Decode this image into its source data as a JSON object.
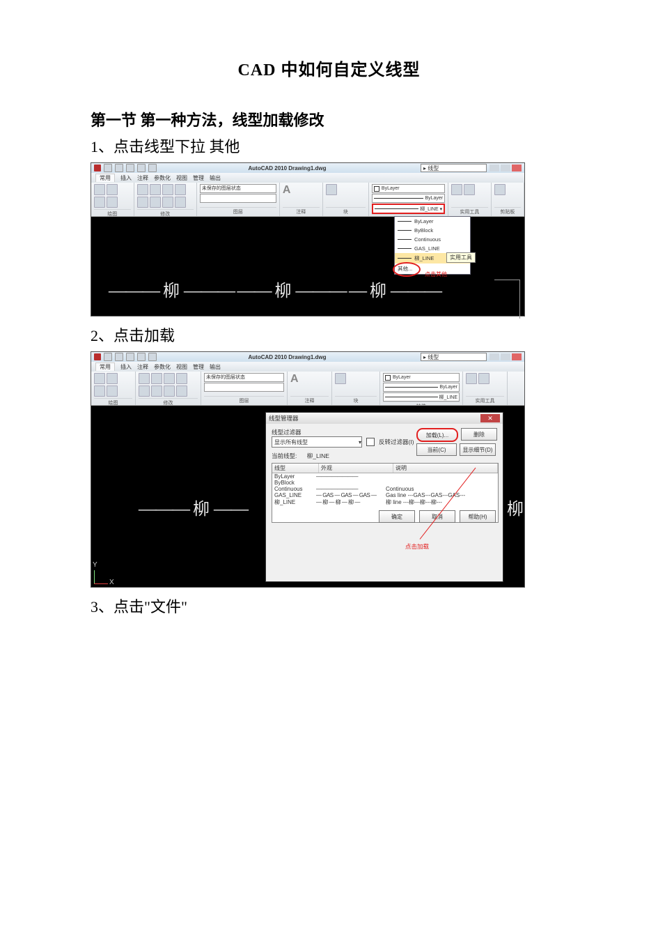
{
  "doc": {
    "title": "CAD 中如何自定义线型",
    "section1": "第一节 第一种方法，线型加载修改",
    "step1": "1、点击线型下拉   其他",
    "step2": "2、点击加载",
    "step3": "3、点击\"文件\""
  },
  "shot_common": {
    "app_title": "AutoCAD 2010   Drawing1.dwg",
    "search_placeholder": "线型",
    "tabs": [
      "常用",
      "插入",
      "注释",
      "参数化",
      "视图",
      "管理",
      "输出"
    ],
    "panels": {
      "draw": "绘图",
      "modify": "修改",
      "layer": "图层",
      "anno": "注释",
      "block": "块",
      "prop": "特性",
      "util": "实用工具",
      "clip": "剪贴板"
    },
    "prop_values": {
      "color": "ByLayer",
      "bylayer": "ByLayer",
      "linetype": "柳_LINE"
    },
    "layer_state": "未保存的图层状态"
  },
  "shot1": {
    "dropdown": {
      "items": [
        "ByLayer",
        "ByBlock",
        "Continuous",
        "GAS_LINE",
        "柳_LINE",
        "其他..."
      ],
      "selected_index": 4
    },
    "tooltip": "实用工具",
    "annotation": "点击其他",
    "canvas_chars": [
      "柳",
      "柳",
      "柳"
    ]
  },
  "shot2": {
    "dialog": {
      "title": "线型管理器",
      "filter_group_label": "线型过滤器",
      "filter_value": "显示所有线型",
      "invert_label": "反转过滤器(I)",
      "btn_load": "加载(L)...",
      "btn_delete": "删除",
      "btn_current": "当前(C)",
      "btn_detail": "显示细节(D)",
      "current_label": "当前线型:",
      "current_value": "柳_LINE",
      "cols": [
        "线型",
        "外观",
        "说明"
      ],
      "rows": [
        {
          "name": "ByLayer",
          "appearance": "————————",
          "desc": ""
        },
        {
          "name": "ByBlock",
          "appearance": "",
          "desc": ""
        },
        {
          "name": "Continuous",
          "appearance": "————————",
          "desc": "Continuous"
        },
        {
          "name": "GAS_LINE",
          "appearance": "— GAS — GAS — GAS —",
          "desc": "Gas line ---GAS---GAS---GAS---"
        },
        {
          "name": "柳_LINE",
          "appearance": "— 柳 — 柳 — 柳 —",
          "desc": "柳 line ---柳---柳---柳---"
        }
      ],
      "ok": "确定",
      "cancel": "取消",
      "help": "帮助(H)"
    },
    "annotation": "点击加载",
    "canvas_char_left": "柳",
    "canvas_char_right": "柳"
  }
}
